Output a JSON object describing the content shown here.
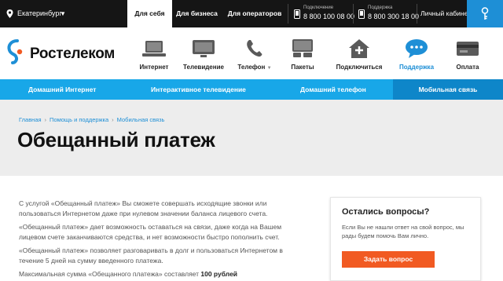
{
  "topbar": {
    "city": "Екатеринбург",
    "segments": [
      "Для себя",
      "Для бизнеса",
      "Для операторов"
    ],
    "phones": [
      {
        "caption": "Подключение",
        "number": "8 800 100 08 00"
      },
      {
        "caption": "Поддержка",
        "number": "8 800 300 18 00"
      }
    ],
    "cabinet": "Личный кабинет"
  },
  "brand": {
    "name": "Ростелеком",
    "accent": "#1e8fd6"
  },
  "nav": {
    "items": [
      {
        "label": "Интернет",
        "icon": "laptop-icon"
      },
      {
        "label": "Телевидение",
        "icon": "tv-icon"
      },
      {
        "label": "Телефон",
        "icon": "handset-icon"
      },
      {
        "label": "Пакеты",
        "icon": "package-icon"
      },
      {
        "label": "Подключиться",
        "icon": "house-plus-icon"
      },
      {
        "label": "Поддержка",
        "icon": "chat-bubble-icon"
      },
      {
        "label": "Оплата",
        "icon": "credit-card-icon"
      }
    ],
    "active": "Поддержка"
  },
  "subnav": {
    "items": [
      "Домашний Интернет",
      "Интерактивное телевидение",
      "Домашний телефон",
      "Мобильная связь"
    ],
    "active": "Мобильная связь"
  },
  "breadcrumbs": [
    "Главная",
    "Помощь и поддержка",
    "Мобильная связь"
  ],
  "page_title": "Обещанный платеж",
  "content": {
    "p1": "С услугой «Обещанный платеж» Вы сможете совершать исходящие звонки или пользоваться Интернетом даже при нулевом значении баланса лицевого счета.",
    "p2": "«Обещанный платеж» дает возможность оставаться на связи, даже когда на Вашем лицевом счете заканчиваются средства, и нет возможности быстро пополнить счет.",
    "p3": "«Обещанный платеж» позволяет разговаривать в долг и пользоваться Интернетом в течение 5 дней на сумму введенного платежа.",
    "p4_prefix": "Максимальная сумма «Обещанного платежа» составляет ",
    "p4_bold": "100 рублей"
  },
  "sidebox": {
    "title": "Остались вопросы?",
    "text": "Если Вы не нашли ответ на свой вопрос, мы рады будем помочь Вам лично.",
    "button": "Задать вопрос",
    "button_color": "#f15a22"
  }
}
